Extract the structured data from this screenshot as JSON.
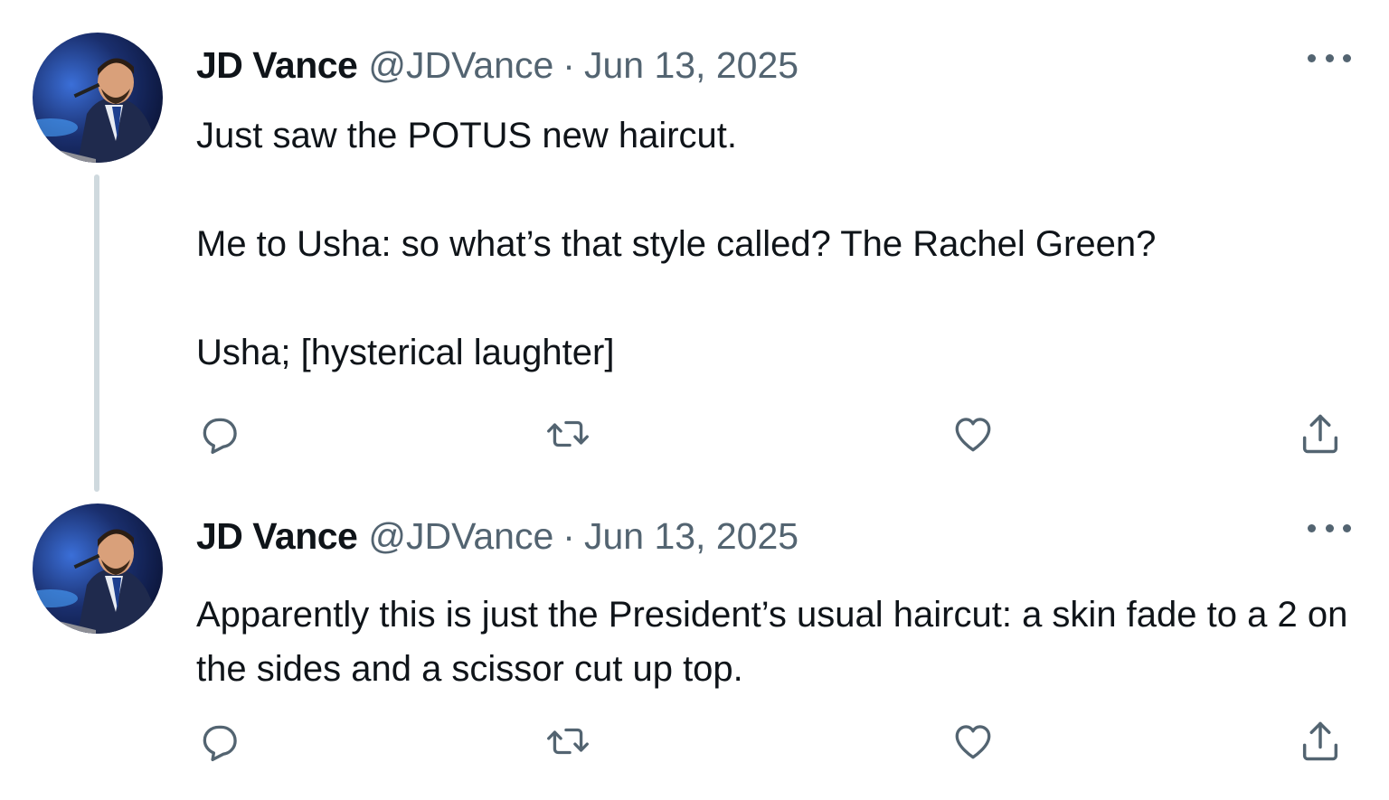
{
  "thread": {
    "tweets": [
      {
        "author_name": "JD Vance",
        "handle": "@JDVance",
        "separator": "·",
        "date": "Jun 13, 2025",
        "paragraphs": [
          "Just saw the POTUS new haircut.",
          "Me to Usha: so what’s that style called? The Rachel Green?",
          "Usha; [hysterical laughter]"
        ],
        "icons": [
          "reply-icon",
          "retweet-icon",
          "like-icon",
          "share-icon",
          "more-icon"
        ]
      },
      {
        "author_name": "JD Vance",
        "handle": "@JDVance",
        "separator": "·",
        "date": "Jun 13, 2025",
        "paragraphs": [
          "Apparently this is just the President’s usual haircut: a skin fade to a 2 on the sides and a scissor cut up top."
        ],
        "icons": [
          "reply-icon",
          "retweet-icon",
          "like-icon",
          "share-icon",
          "more-icon"
        ]
      }
    ]
  },
  "colors": {
    "text_primary": "#0f1419",
    "text_secondary": "#536471",
    "thread_line": "#cfd9de",
    "background": "#ffffff"
  }
}
